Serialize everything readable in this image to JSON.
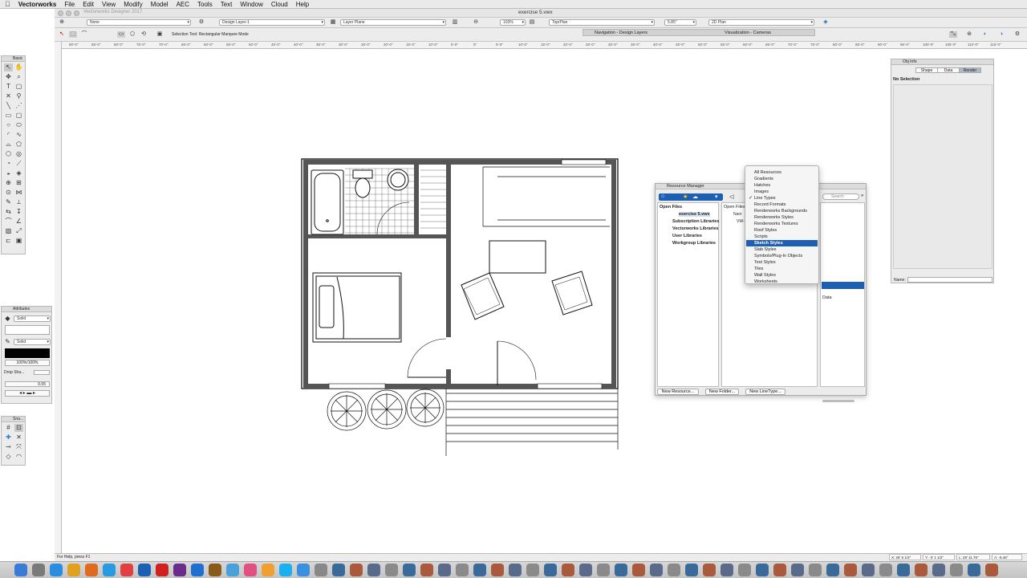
{
  "menubar": {
    "apple": "",
    "app": "Vectorworks",
    "items": [
      "File",
      "Edit",
      "View",
      "Modify",
      "Model",
      "AEC",
      "Tools",
      "Text",
      "Window",
      "Cloud",
      "Help"
    ]
  },
  "window": {
    "app_title": "Vectorworks Designer 2017",
    "doc_title": "exercise 5.vwx"
  },
  "viewbar": {
    "class_value": "None",
    "layer_value": "Design Layer-1",
    "layer_plane": "Layer Plane",
    "zoom": "103%",
    "view": "Top/Plan",
    "elevation": "5.85\"",
    "render_mode": "2D Plan"
  },
  "toolbar": {
    "mode_text": "Selection Tool: Rectangular Marquee Mode",
    "nav_palette": "Navigation - Design Layers",
    "viz_palette": "Visualization - Cameras"
  },
  "rulers": {
    "h_labels": [
      "90'-0\"",
      "85'-0\"",
      "80'-0\"",
      "75'-0\"",
      "70'-0\"",
      "65'-0\"",
      "60'-0\"",
      "55'-0\"",
      "50'-0\"",
      "45'-0\"",
      "40'-0\"",
      "35'-0\"",
      "30'-0\"",
      "25'-0\"",
      "20'-0\"",
      "15'-0\"",
      "10'-0\"",
      "5'-0\"",
      "0\"",
      "5'-0\"",
      "10'-0\"",
      "15'-0\"",
      "20'-0\"",
      "25'-0\"",
      "30'-0\"",
      "35'-0\"",
      "40'-0\"",
      "45'-0\"",
      "50'-0\"",
      "55'-0\"",
      "60'-0\"",
      "65'-0\"",
      "70'-0\"",
      "75'-0\"",
      "80'-0\"",
      "85'-0\"",
      "90'-0\"",
      "95'-0\"",
      "100'-0\"",
      "105'-0\"",
      "110'-0\"",
      "115'-0\""
    ]
  },
  "palettes": {
    "basic": "Basic",
    "attributes": "Attributes",
    "attr_fill": "Solid",
    "attr_pen": "Solid",
    "attr_opacity": "100%/100%",
    "drop_shadow": "Drop Sha...",
    "line_weight": "0.05",
    "snapping": "Sna..."
  },
  "obj_info": {
    "title": "Obj Info",
    "tabs": [
      "Shape",
      "Data",
      "Render"
    ],
    "status": "No Selection",
    "name_label": "Name:"
  },
  "resource_manager": {
    "title": "Resource Manager",
    "search_placeholder": "Search",
    "tree": [
      "Open Files",
      "exercise 5.vwx",
      "Subscription Libraries",
      "Vectorworks Libraries",
      "User Libraries",
      "Workgroup Libraries"
    ],
    "open_files_header": "Open Files",
    "name_col": "Nam",
    "row1": "VW-",
    "data_label": "Data",
    "btn_new_resource": "New Resource...",
    "btn_new_folder": "New Folder...",
    "btn_new_linetype": "New LineType..."
  },
  "resource_type_menu": {
    "items": [
      "All Resources",
      "Gradients",
      "Hatches",
      "Images",
      "Line Types",
      "Record Formats",
      "Renderworks Backgrounds",
      "Renderworks Styles",
      "Renderworks Textures",
      "Roof Styles",
      "Scripts",
      "Sketch Styles",
      "Slab Styles",
      "Symbols/Plug-In Objects",
      "Text Styles",
      "Tiles",
      "Wall Styles",
      "Worksheets"
    ],
    "checked": "Line Types",
    "highlighted": "Sketch Styles"
  },
  "statusbar": {
    "help": "For Help, press F1",
    "x": "X: 28' 6 1/2\"",
    "y": "Y: -3' 1 1/2\"",
    "l": "L: 28' 11.76\"",
    "a": "A: -6.46°"
  },
  "dock": {
    "icons": [
      "finder-icon",
      "launchpad-icon",
      "app-store-icon",
      "chrome-icon",
      "firefox-icon",
      "safari-icon",
      "calendar-icon",
      "vectorworks-icon",
      "acrobat-icon",
      "indesign-icon",
      "photoshop-icon",
      "bridge-icon",
      "preview-icon",
      "itunes-icon",
      "photos-icon",
      "skype-icon",
      "mail-icon",
      "trash-icon"
    ]
  }
}
